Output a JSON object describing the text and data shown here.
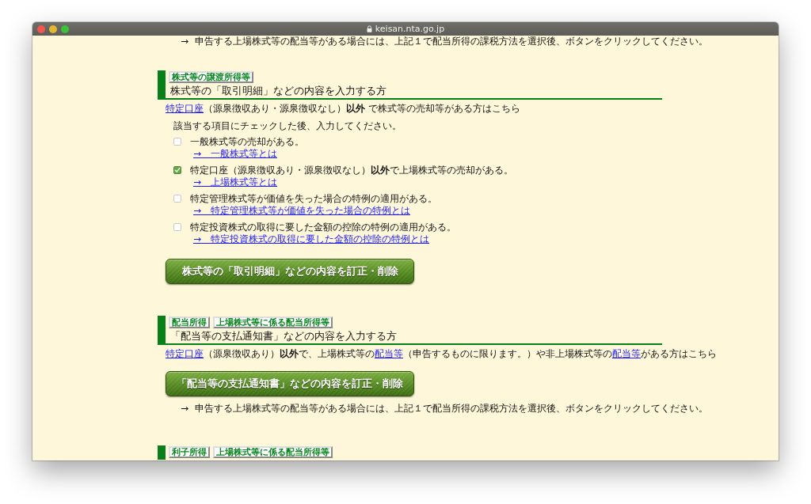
{
  "window": {
    "url": "keisan.nta.go.jp"
  },
  "top_note": {
    "arrow": "→",
    "text": "申告する上場株式等の配当等がある場合には、上記１で配当所得の課税方法を選択後、ボタンをクリックしてください。"
  },
  "sections": [
    {
      "tags": [
        "株式等の譲渡所得等"
      ],
      "heading": "株式等の「取引明細」などの内容を入力する方",
      "intro": [
        {
          "kind": "link",
          "text": "特定口座"
        },
        {
          "kind": "text",
          "text": "（源泉徴収あり・源泉徴収なし）**以外** で株式等の売却等がある方はこちら"
        }
      ],
      "instruction": "該当する項目にチェックした後、入力してください。",
      "options": [
        {
          "label": "一般株式等の売却がある。",
          "checked": false,
          "link": "→　一般株式等とは"
        },
        {
          "label": "特定口座（源泉徴収あり・源泉徴収なし）**以外**で上場株式等の売却がある。",
          "checked": true,
          "link": "→　上場株式等とは"
        },
        {
          "label": "特定管理株式等が価値を失った場合の特例の適用がある。",
          "checked": false,
          "link": "→　特定管理株式等が価値を失った場合の特例とは"
        },
        {
          "label": "特定投資株式の取得に要した金額の控除の特例の適用がある。",
          "checked": false,
          "link": "→　特定投資株式の取得に要した金額の控除の特例とは"
        }
      ],
      "button": "株式等の「取引明細」などの内容を訂正・削除"
    },
    {
      "tags": [
        "配当所得",
        "上場株式等に係る配当所得等"
      ],
      "heading": "「配当等の支払通知書」などの内容を入力する方",
      "intro": [
        {
          "kind": "link",
          "text": "特定口座"
        },
        {
          "kind": "text",
          "text": "（源泉徴収あり）**以外**で、上場株式等の"
        },
        {
          "kind": "link",
          "text": "配当等"
        },
        {
          "kind": "text",
          "text": "（申告するものに限ります。）や非上場株式等の"
        },
        {
          "kind": "link",
          "text": "配当等"
        },
        {
          "kind": "text",
          "text": "がある方はこちら"
        }
      ],
      "button": "「配当等の支払通知書」などの内容を訂正・削除",
      "note": {
        "arrow": "→",
        "text": "申告する上場株式等の配当等がある場合には、上記１で配当所得の課税方法を選択後、ボタンをクリックしてください。"
      }
    },
    {
      "tags": [
        "利子所得",
        "上場株式等に係る配当所得等"
      ]
    }
  ]
}
